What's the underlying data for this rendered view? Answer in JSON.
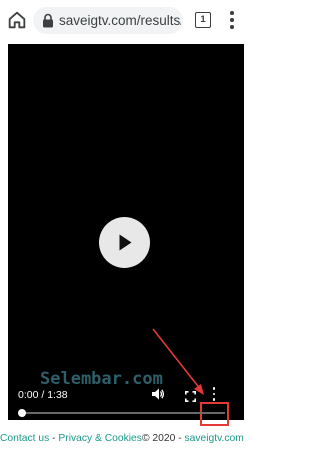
{
  "browser": {
    "url": "saveigtv.com/results/?",
    "tab_count": "1",
    "icons": [
      "home-icon",
      "lock-icon",
      "tab-switcher-icon",
      "more-vert-icon"
    ]
  },
  "player": {
    "time": "0:00 / 1:38",
    "watermark": "Selembar.com",
    "progress": 0,
    "controls": [
      "play-icon",
      "volume-icon",
      "fullscreen-icon",
      "more-options-icon"
    ],
    "highlight_color": "#e53935"
  },
  "footer": {
    "contact": "Contact us",
    "separator": " - ",
    "privacy": "Privacy & Cookies",
    "copyright": "© 2020 - ",
    "site": "saveigtv.com",
    "link_color": "#1a9a8b"
  }
}
